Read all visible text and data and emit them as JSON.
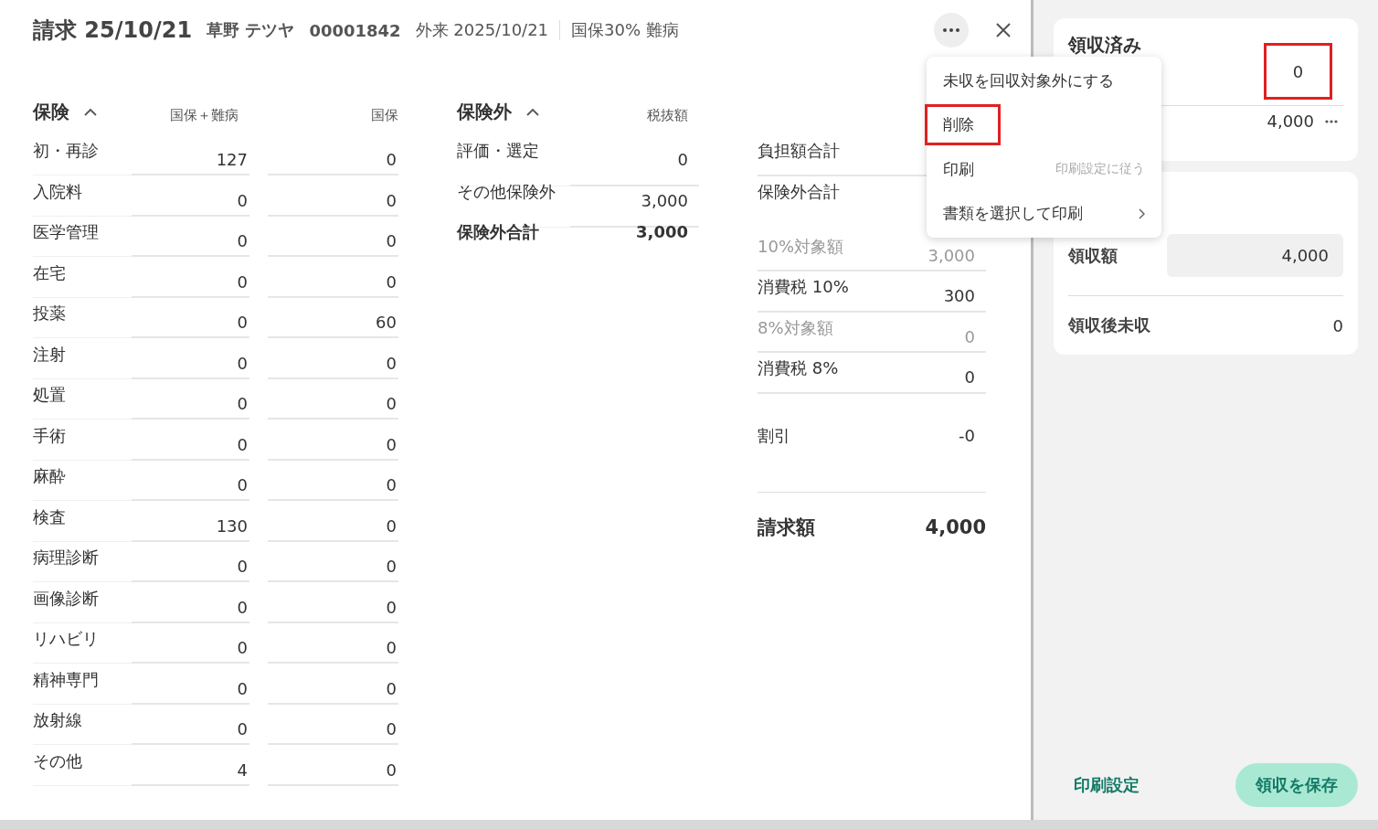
{
  "header": {
    "title": "請求 25/10/21",
    "patient_name": "草野 テツヤ",
    "patient_id": "00001842",
    "visit": "外来 2025/10/21",
    "insurance": "国保30% 難病"
  },
  "insurance": {
    "title": "保険",
    "expanded": true,
    "columns": [
      "国保＋難病",
      "国保"
    ],
    "rows": [
      {
        "label": "初・再診",
        "values": [
          "127",
          "0"
        ]
      },
      {
        "label": "入院料",
        "values": [
          "0",
          "0"
        ]
      },
      {
        "label": "医学管理",
        "values": [
          "0",
          "0"
        ]
      },
      {
        "label": "在宅",
        "values": [
          "0",
          "0"
        ]
      },
      {
        "label": "投薬",
        "values": [
          "0",
          "60"
        ]
      },
      {
        "label": "注射",
        "values": [
          "0",
          "0"
        ]
      },
      {
        "label": "処置",
        "values": [
          "0",
          "0"
        ]
      },
      {
        "label": "手術",
        "values": [
          "0",
          "0"
        ]
      },
      {
        "label": "麻酔",
        "values": [
          "0",
          "0"
        ]
      },
      {
        "label": "検査",
        "values": [
          "130",
          "0"
        ]
      },
      {
        "label": "病理診断",
        "values": [
          "0",
          "0"
        ]
      },
      {
        "label": "画像診断",
        "values": [
          "0",
          "0"
        ]
      },
      {
        "label": "リハビリ",
        "values": [
          "0",
          "0"
        ]
      },
      {
        "label": "精神専門",
        "values": [
          "0",
          "0"
        ]
      },
      {
        "label": "放射線",
        "values": [
          "0",
          "0"
        ]
      },
      {
        "label": "その他",
        "values": [
          "4",
          "0"
        ]
      }
    ]
  },
  "non_insurance": {
    "title": "保険外",
    "expanded": true,
    "column": "税抜額",
    "rows": [
      {
        "label": "評価・選定",
        "value": "0",
        "kind": "item"
      },
      {
        "label": "その他保険外",
        "value": "3,000",
        "kind": "item"
      },
      {
        "label": "保険外合計",
        "value": "3,000",
        "kind": "total"
      }
    ]
  },
  "summary": {
    "rows": [
      {
        "label": "負担額合計",
        "kind": "normal"
      },
      {
        "label": "保険外合計",
        "kind": "normal"
      },
      {
        "label": "10%対象額",
        "value": "3,000",
        "kind": "muted"
      },
      {
        "label": "消費税 10%",
        "value": "300",
        "kind": "normal"
      },
      {
        "label": "8%対象額",
        "value": "0",
        "kind": "muted"
      },
      {
        "label": "消費税 8%",
        "value": "0",
        "kind": "normal"
      },
      {
        "label": "割引",
        "value": "-0",
        "kind": "discount"
      },
      {
        "label": "請求額",
        "value": "4,000",
        "kind": "total"
      }
    ]
  },
  "menu": {
    "items": [
      {
        "label": "未収を回収対象外にする",
        "submenu": false,
        "highlighted": false
      },
      {
        "label": "削除",
        "submenu": false,
        "highlighted": true
      },
      {
        "label": "印刷",
        "hint": "印刷設定に従う",
        "submenu": false,
        "highlighted": false
      },
      {
        "label": "書類を選択して印刷",
        "submenu": true,
        "highlighted": false
      }
    ]
  },
  "received": {
    "title": "領収済み",
    "amount": "0",
    "amount_highlighted": true,
    "sub_amount": "4,000"
  },
  "payment": {
    "received_label": "領収額",
    "received_value": "4,000",
    "remaining_label": "領収後未収",
    "remaining_value": "0"
  },
  "footer": {
    "print_settings": "印刷設定",
    "save": "領収を保存"
  }
}
